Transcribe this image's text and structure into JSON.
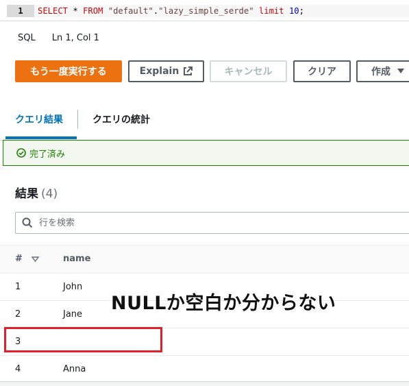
{
  "editor": {
    "line_number": "1",
    "code": {
      "select": "SELECT",
      "star": " * ",
      "from": "FROM",
      "space": " ",
      "db": "\"default\"",
      "dot": ".",
      "table": "\"lazy_simple_serde\"",
      "space2": " ",
      "limit": "limit",
      "space3": " ",
      "limit_value": "10",
      "semicolon": ";"
    }
  },
  "status": {
    "language": "SQL",
    "position": "Ln 1, Col 1"
  },
  "toolbar": {
    "run_again": "もう一度実行する",
    "explain": "Explain",
    "cancel": "キャンセル",
    "clear": "クリア",
    "create": "作成"
  },
  "tabs": [
    {
      "label": "クエリ結果"
    },
    {
      "label": "クエリの統計"
    }
  ],
  "banner": {
    "text": "完了済み"
  },
  "results": {
    "title": "結果",
    "count": "(4)",
    "search_placeholder": "行を検索",
    "columns": {
      "hash": "#",
      "name": "name"
    },
    "rows": [
      {
        "id": "1",
        "name": "John"
      },
      {
        "id": "2",
        "name": "Jane"
      },
      {
        "id": "3",
        "name": ""
      },
      {
        "id": "4",
        "name": "Anna"
      }
    ]
  },
  "annotation": {
    "text": "NULLか空白か分からない",
    "box_color": "#e0202a"
  },
  "colors": {
    "primary": "#ec7211",
    "tab_active": "#0073bb",
    "success": "#1d8102"
  }
}
